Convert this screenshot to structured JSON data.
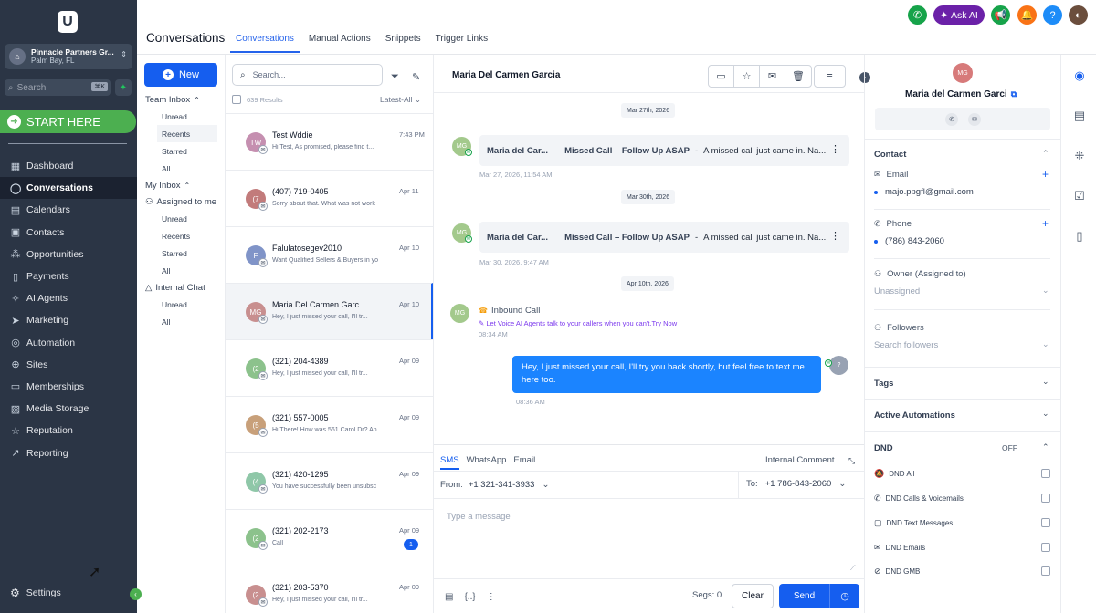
{
  "sidebar": {
    "logo": "U",
    "account": {
      "name": "Pinnacle Partners Gr...",
      "location": "Palm Bay, FL"
    },
    "search": {
      "placeholder": "Search",
      "shortcut": "⌘K"
    },
    "start_here": "START HERE",
    "nav": [
      {
        "label": "Dashboard",
        "icon": "dashboard-icon"
      },
      {
        "label": "Conversations",
        "icon": "chat-icon",
        "active": true
      },
      {
        "label": "Calendars",
        "icon": "calendar-icon"
      },
      {
        "label": "Contacts",
        "icon": "contacts-icon"
      },
      {
        "label": "Opportunities",
        "icon": "opportunities-icon"
      },
      {
        "label": "Payments",
        "icon": "payments-icon"
      },
      {
        "label": "AI Agents",
        "icon": "ai-agents-icon"
      },
      {
        "label": "Marketing",
        "icon": "marketing-icon"
      },
      {
        "label": "Automation",
        "icon": "automation-icon"
      },
      {
        "label": "Sites",
        "icon": "globe-icon"
      },
      {
        "label": "Memberships",
        "icon": "memberships-icon"
      },
      {
        "label": "Media Storage",
        "icon": "media-icon"
      },
      {
        "label": "Reputation",
        "icon": "star-icon"
      },
      {
        "label": "Reporting",
        "icon": "chart-icon"
      }
    ],
    "settings": "Settings"
  },
  "topbar": {
    "ask_ai": "Ask AI"
  },
  "header": {
    "title": "Conversations",
    "tabs": [
      "Conversations",
      "Manual Actions",
      "Snippets",
      "Trigger Links"
    ]
  },
  "inbox": {
    "new_label": "New",
    "team_inbox": "Team Inbox",
    "team_items": [
      "Unread",
      "Recents",
      "Starred",
      "All"
    ],
    "my_inbox": "My Inbox",
    "assigned": "Assigned to me",
    "assigned_items": [
      "Unread",
      "Recents",
      "Starred",
      "All"
    ],
    "internal_chat": "Internal Chat",
    "internal_items": [
      "Unread",
      "All"
    ]
  },
  "list": {
    "search_placeholder": "Search...",
    "results": "639 Results",
    "sort": "Latest-All",
    "conversations": [
      {
        "initials": "TW",
        "name": "Test Wddie",
        "preview": "Hi Test, As promised, please find t...",
        "date": "7:43 PM",
        "color": "#c58fb0"
      },
      {
        "initials": "(7",
        "name": "(407) 719-0405",
        "preview": "Sorry about that. What was not work",
        "date": "Apr 11",
        "color": "#c27b7b"
      },
      {
        "initials": "F",
        "name": "Falulatosegev2010",
        "preview": "Want Qualified Sellers & Buyers in yo",
        "date": "Apr 10",
        "color": "#8094c8"
      },
      {
        "initials": "MG",
        "name": "Maria Del Carmen Garc...",
        "preview": "Hey, I just missed your call, I'll tr...",
        "date": "Apr 10",
        "color": "#c88f8f"
      },
      {
        "initials": "(2",
        "name": "(321) 204-4389",
        "preview": "Hey, I just missed your call, I'll tr...",
        "date": "Apr 09",
        "color": "#8cc28c"
      },
      {
        "initials": "(5",
        "name": "(321) 557-0005",
        "preview": "Hi There! How was 561 Carol Dr? An",
        "date": "Apr 09",
        "color": "#c8a07a"
      },
      {
        "initials": "(4",
        "name": "(321) 420-1295",
        "preview": "You have successfully been unsubsc",
        "date": "Apr 09",
        "color": "#8fc7a8"
      },
      {
        "initials": "(2",
        "name": "(321) 202-2173",
        "preview": "Call",
        "date": "Apr 09",
        "color": "#8cc28c",
        "unread": "1"
      },
      {
        "initials": "(2",
        "name": "(321) 203-5370",
        "preview": "Hey, I just missed your call, I'll tr...",
        "date": "Apr 09",
        "color": "#c88f8f"
      }
    ]
  },
  "chat": {
    "contact_name": "Maria Del Carmen Garcia",
    "dates": [
      "Mar 27th, 2026",
      "Mar 30th, 2026",
      "Apr 10th, 2026"
    ],
    "missed_calls": [
      {
        "from": "Maria del Car...",
        "subject": "Missed Call – Follow Up ASAP",
        "body": "A missed call just came in. Na...",
        "time": "Mar 27, 2026, 11:54 AM",
        "initials": "MG"
      },
      {
        "from": "Maria del Car...",
        "subject": "Missed Call – Follow Up ASAP",
        "body": "A missed call just came in. Na...",
        "time": "Mar 30, 2026, 9:47 AM",
        "initials": "MG"
      }
    ],
    "inbound": {
      "label": "Inbound Call",
      "promo": "Let Voice AI Agents talk to your callers when you can't.",
      "promo_link": "Try Now",
      "time": "08:34 AM",
      "initials": "MG"
    },
    "outbound": {
      "text": "Hey, I just missed your call, I'll try you back shortly, but feel free to text me here too.",
      "time": "08:36 AM",
      "initials": "?"
    }
  },
  "composer": {
    "tabs": [
      "SMS",
      "WhatsApp",
      "Email"
    ],
    "internal_comment": "Internal Comment",
    "from_label": "From:",
    "from_value": "+1 321-341-3933",
    "to_label": "To:",
    "to_value": "+1 786-843-2060",
    "placeholder": "Type a message",
    "segs": "Segs: 0",
    "clear": "Clear",
    "send": "Send"
  },
  "contact": {
    "initials": "MG",
    "name": "Maria del Carmen Garci",
    "section_contact": "Contact",
    "email_label": "Email",
    "email": "majo.ppgfl@gmail.com",
    "phone_label": "Phone",
    "phone": "(786) 843-2060",
    "owner_label": "Owner (Assigned to)",
    "owner_placeholder": "Unassigned",
    "followers_label": "Followers",
    "followers_placeholder": "Search followers",
    "tags": "Tags",
    "automations": "Active Automations",
    "dnd": "DND",
    "dnd_state": "OFF",
    "dnd_items": [
      "DND All",
      "DND Calls & Voicemails",
      "DND Text Messages",
      "DND Emails",
      "DND GMB"
    ]
  }
}
